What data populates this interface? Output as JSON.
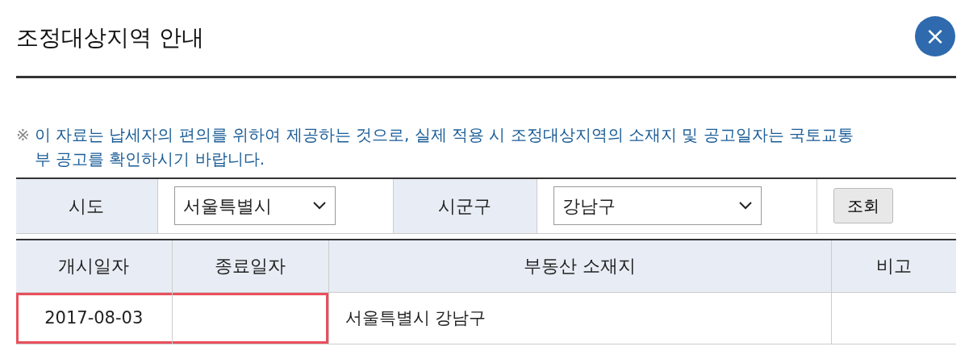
{
  "dialog": {
    "title": "조정대상지역 안내",
    "close_label": "×"
  },
  "notice": {
    "mark": "※",
    "text": "이 자료는 납세자의 편의를 위하여 제공하는 것으로, 실제 적용 시 조정대상지역의 소재지 및  공고일자는 국토교통부 공고를 확인하시기 바랍니다."
  },
  "search": {
    "fields": [
      {
        "label": "시도",
        "value": "서울특별시"
      },
      {
        "label": "시군구",
        "value": "강남구"
      }
    ],
    "button": "조회"
  },
  "table": {
    "columns": [
      "개시일자",
      "종료일자",
      "부동산 소재지",
      "비고"
    ],
    "rows": [
      {
        "cells": [
          {
            "text": "2017-08-03",
            "highlighted": true
          },
          {
            "highlighted": true
          },
          {
            "text": "서울특별시 강남구",
            "highlighted": false
          },
          {
            "highlighted": false
          }
        ]
      }
    ]
  }
}
